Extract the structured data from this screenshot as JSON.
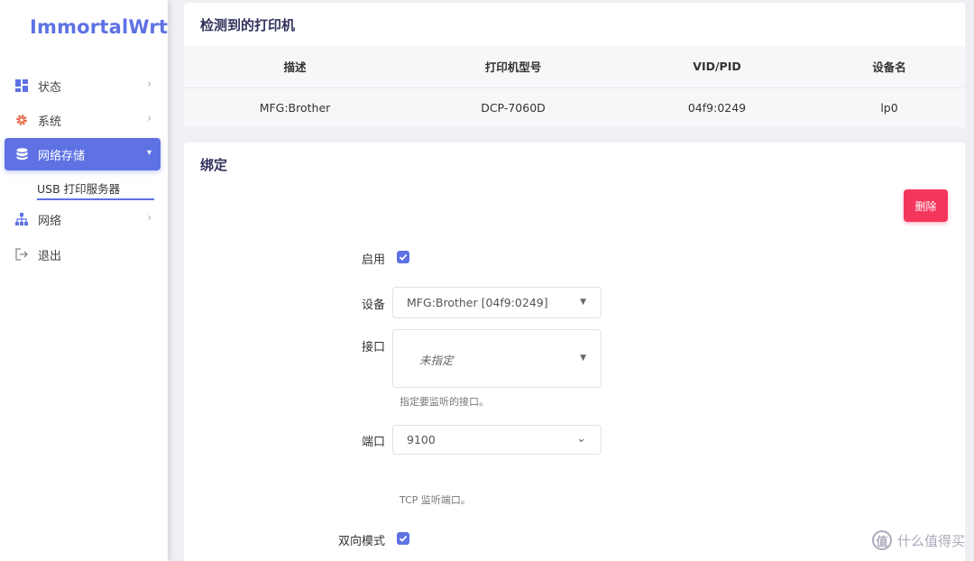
{
  "app": {
    "logo": "ImmortalWrt"
  },
  "sidebar": {
    "items": [
      {
        "label": "状态",
        "icon": "dashboard-icon"
      },
      {
        "label": "系统",
        "icon": "gear-icon"
      },
      {
        "label": "网络存储",
        "icon": "database-icon",
        "active": true
      },
      {
        "label": "网络",
        "icon": "network-icon"
      },
      {
        "label": "退出",
        "icon": "logout-icon"
      }
    ],
    "subitem": "USB 打印服务器"
  },
  "detected": {
    "title": "检测到的打印机",
    "headers": [
      "描述",
      "打印机型号",
      "VID/PID",
      "设备名"
    ],
    "rows": [
      [
        "MFG:Brother",
        "DCP-7060D",
        "04f9:0249",
        "lp0"
      ]
    ]
  },
  "binding": {
    "title": "绑定",
    "delete_label": "删除",
    "enable_label": "启用",
    "enable_checked": true,
    "device_label": "设备",
    "device_value": "MFG:Brother [04f9:0249]",
    "interface_label": "接口",
    "interface_value": "未指定",
    "interface_hint": "指定要监听的接口。",
    "port_label": "端口",
    "port_value": "9100",
    "port_hint": "TCP 监听端口。",
    "bidir_label": "双向模式",
    "bidir_checked": true
  },
  "watermark": {
    "text": "什么值得买",
    "glyph": "值"
  },
  "colors": {
    "accent": "#5e72e4",
    "danger": "#f5365c"
  }
}
